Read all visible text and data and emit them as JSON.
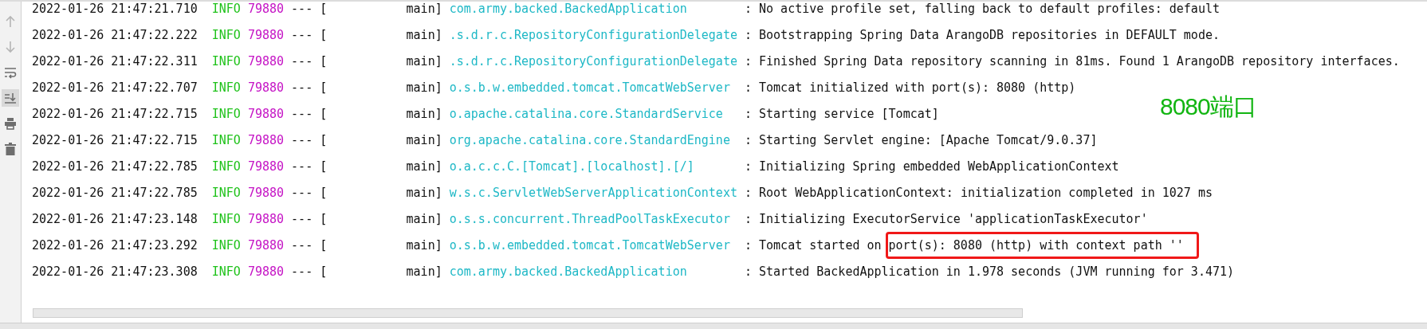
{
  "toolbar": [
    {
      "kind": "up",
      "selected": false,
      "disabled": true
    },
    {
      "kind": "down",
      "selected": false,
      "disabled": true
    },
    {
      "kind": "wrap",
      "selected": false,
      "disabled": false
    },
    {
      "kind": "scroll-end",
      "selected": true,
      "disabled": false
    },
    {
      "kind": "print",
      "selected": false,
      "disabled": false
    },
    {
      "kind": "trash",
      "selected": false,
      "disabled": false
    }
  ],
  "log_lines": [
    {
      "timestamp": "2022-01-26 21:47:21.710",
      "level": "INFO",
      "pid": "79880",
      "separator": "---",
      "thread_open": "[",
      "thread": "main]",
      "logger": "com.army.backed.BackedApplication",
      "colon": ":",
      "message": "No active profile set, falling back to default profiles: default"
    },
    {
      "timestamp": "2022-01-26 21:47:22.222",
      "level": "INFO",
      "pid": "79880",
      "separator": "---",
      "thread_open": "[",
      "thread": "main]",
      "logger": ".s.d.r.c.RepositoryConfigurationDelegate",
      "colon": ":",
      "message": "Bootstrapping Spring Data ArangoDB repositories in DEFAULT mode."
    },
    {
      "timestamp": "2022-01-26 21:47:22.311",
      "level": "INFO",
      "pid": "79880",
      "separator": "---",
      "thread_open": "[",
      "thread": "main]",
      "logger": ".s.d.r.c.RepositoryConfigurationDelegate",
      "colon": ":",
      "message": "Finished Spring Data repository scanning in 81ms. Found 1 ArangoDB repository interfaces."
    },
    {
      "timestamp": "2022-01-26 21:47:22.707",
      "level": "INFO",
      "pid": "79880",
      "separator": "---",
      "thread_open": "[",
      "thread": "main]",
      "logger": "o.s.b.w.embedded.tomcat.TomcatWebServer",
      "colon": ":",
      "message": "Tomcat initialized with port(s): 8080 (http)"
    },
    {
      "timestamp": "2022-01-26 21:47:22.715",
      "level": "INFO",
      "pid": "79880",
      "separator": "---",
      "thread_open": "[",
      "thread": "main]",
      "logger": "o.apache.catalina.core.StandardService",
      "colon": ":",
      "message": "Starting service [Tomcat]"
    },
    {
      "timestamp": "2022-01-26 21:47:22.715",
      "level": "INFO",
      "pid": "79880",
      "separator": "---",
      "thread_open": "[",
      "thread": "main]",
      "logger": "org.apache.catalina.core.StandardEngine",
      "colon": ":",
      "message": "Starting Servlet engine: [Apache Tomcat/9.0.37]"
    },
    {
      "timestamp": "2022-01-26 21:47:22.785",
      "level": "INFO",
      "pid": "79880",
      "separator": "---",
      "thread_open": "[",
      "thread": "main]",
      "logger": "o.a.c.c.C.[Tomcat].[localhost].[/]",
      "colon": ":",
      "message": "Initializing Spring embedded WebApplicationContext"
    },
    {
      "timestamp": "2022-01-26 21:47:22.785",
      "level": "INFO",
      "pid": "79880",
      "separator": "---",
      "thread_open": "[",
      "thread": "main]",
      "logger": "w.s.c.ServletWebServerApplicationContext",
      "colon": ":",
      "message": "Root WebApplicationContext: initialization completed in 1027 ms"
    },
    {
      "timestamp": "2022-01-26 21:47:23.148",
      "level": "INFO",
      "pid": "79880",
      "separator": "---",
      "thread_open": "[",
      "thread": "main]",
      "logger": "o.s.s.concurrent.ThreadPoolTaskExecutor",
      "colon": ":",
      "message": "Initializing ExecutorService 'applicationTaskExecutor'"
    },
    {
      "timestamp": "2022-01-26 21:47:23.292",
      "level": "INFO",
      "pid": "79880",
      "separator": "---",
      "thread_open": "[",
      "thread": "main]",
      "logger": "o.s.b.w.embedded.tomcat.TomcatWebServer",
      "colon": ":",
      "message": "Tomcat started on",
      "highlighted": "port(s): 8080 (http) with context path ''"
    },
    {
      "timestamp": "2022-01-26 21:47:23.308",
      "level": "INFO",
      "pid": "79880",
      "separator": "---",
      "thread_open": "[",
      "thread": "main]",
      "logger": "com.army.backed.BackedApplication",
      "colon": ":",
      "message": "Started BackedApplication in 1.978 seconds (JVM running for 3.471)"
    }
  ],
  "annotation": {
    "text": "8080端口"
  }
}
